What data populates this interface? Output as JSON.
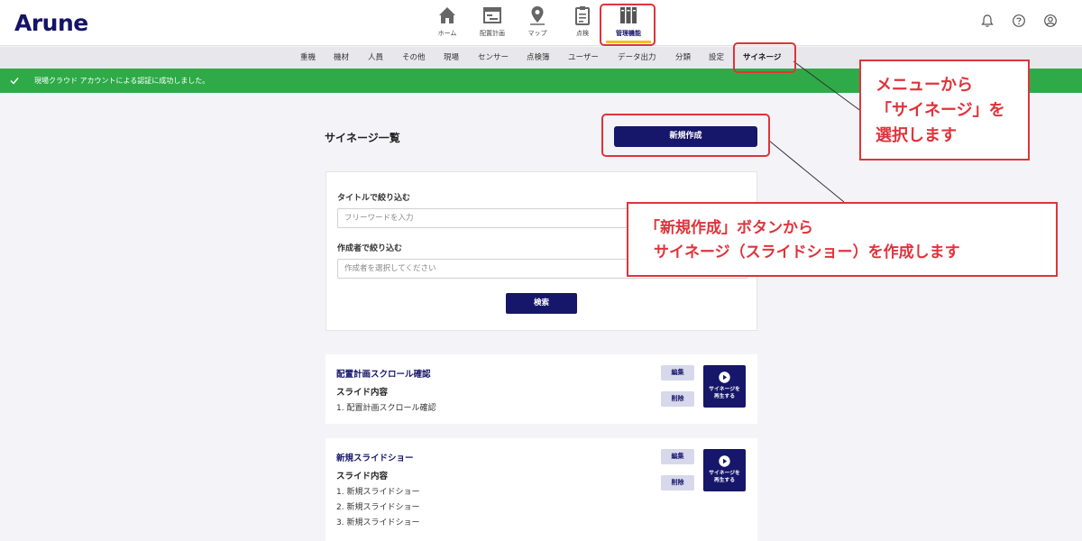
{
  "app": {
    "logo": "Arune"
  },
  "main_nav": [
    {
      "label": "ホーム",
      "icon": "home-icon"
    },
    {
      "label": "配置計画",
      "icon": "layout-plan-icon"
    },
    {
      "label": "マップ",
      "icon": "map-pin-icon"
    },
    {
      "label": "点検",
      "icon": "clipboard-icon"
    },
    {
      "label": "管理機能",
      "icon": "management-icon",
      "active": true
    }
  ],
  "header_icons": [
    "bell-icon",
    "help-icon",
    "user-icon"
  ],
  "sub_nav": [
    "重機",
    "機材",
    "人員",
    "その他",
    "現場",
    "センサー",
    "点検簿",
    "ユーザー",
    "データ出力",
    "分類",
    "設定",
    "サイネージ"
  ],
  "sub_nav_active": "サイネージ",
  "alert": {
    "message": "現場クラウド アカウントによる認証に成功しました。"
  },
  "page": {
    "title": "サイネージ一覧",
    "new_button": "新規作成"
  },
  "filter": {
    "title_label": "タイトルで絞り込む",
    "title_placeholder": "フリーワードを入力",
    "author_label": "作成者で絞り込む",
    "author_placeholder": "作成者を選択してください",
    "search_button": "検索"
  },
  "signages": [
    {
      "title": "配置計画スクロール確認",
      "content_label": "スライド内容",
      "slides": [
        "1. 配置計画スクロール確認"
      ],
      "edit": "編集",
      "delete": "削除",
      "play": [
        "サイネージを",
        "再生する"
      ]
    },
    {
      "title": "新規スライドショー",
      "content_label": "スライド内容",
      "slides": [
        "1. 新規スライドショー",
        "2. 新規スライドショー",
        "3. 新規スライドショー"
      ],
      "edit": "編集",
      "delete": "削除",
      "play": [
        "サイネージを",
        "再生する"
      ]
    }
  ],
  "annotations": {
    "menu_callout": [
      "メニューから",
      "「サイネージ」を",
      "選択します"
    ],
    "button_callout": [
      "「新規作成」ボタンから",
      "サイネージ（スライドショー）を作成します"
    ]
  },
  "colors": {
    "brand": "#16166a",
    "success": "#2eaa48",
    "annotation": "#e0333b",
    "active_underline": "#f4c020"
  }
}
